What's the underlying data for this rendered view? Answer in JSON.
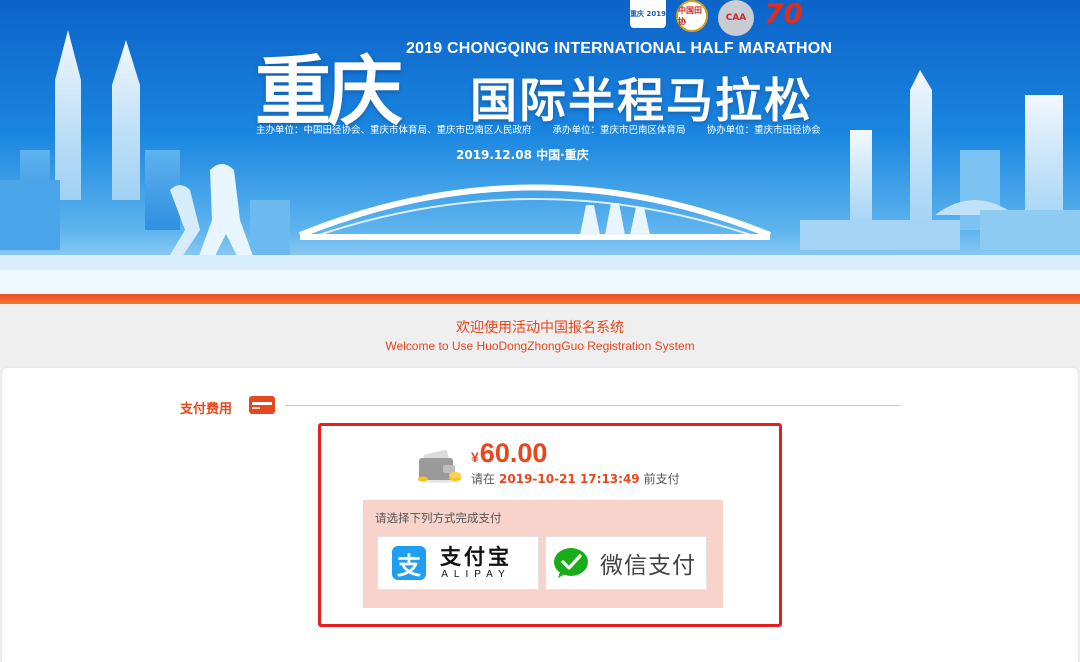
{
  "banner": {
    "logos": {
      "logo1": "重庆 2019",
      "logo2": "中国田协",
      "logo3": "CAA",
      "logo4": "70"
    },
    "event_en": "2019 CHONGQING INTERNATIONAL HALF MARATHON",
    "event_cn_big": "重庆",
    "event_cn": "国际半程马拉松",
    "organizers": {
      "host": "主办单位：中国田径协会、重庆市体育局、重庆市巴南区人民政府",
      "undertaker": "承办单位：重庆市巴南区体育局",
      "co_organizer": "协办单位：重庆市田径协会"
    },
    "date": "2019.12.08  中国·重庆"
  },
  "welcome": {
    "cn": "欢迎使用活动中国报名系统",
    "en": "Welcome to Use HuoDongZhongGuo Registration System"
  },
  "payment": {
    "section_title": "支付费用",
    "currency_symbol": "¥",
    "amount": "60.00",
    "deadline_prefix": "请在",
    "deadline_time": "2019-10-21 17:13:49",
    "deadline_suffix": "前支付",
    "method_hint": "请选择下列方式完成支付",
    "alipay_icon_char": "支",
    "alipay_cn": "支付宝",
    "alipay_en": "ALIPAY",
    "wechat_label": "微信支付"
  },
  "colors": {
    "accent": "#e8461d",
    "alert_border": "#e51f1f",
    "alipay_blue": "#1f9ff2",
    "wechat_green": "#1aad19",
    "panel_bg": "#f8d3cb",
    "banner_blue": "#0c63c8"
  },
  "icons": {
    "wallet": "wallet-icon",
    "money": "money-wallet-icon",
    "alipay": "alipay-icon",
    "wechat": "wechat-pay-icon"
  }
}
